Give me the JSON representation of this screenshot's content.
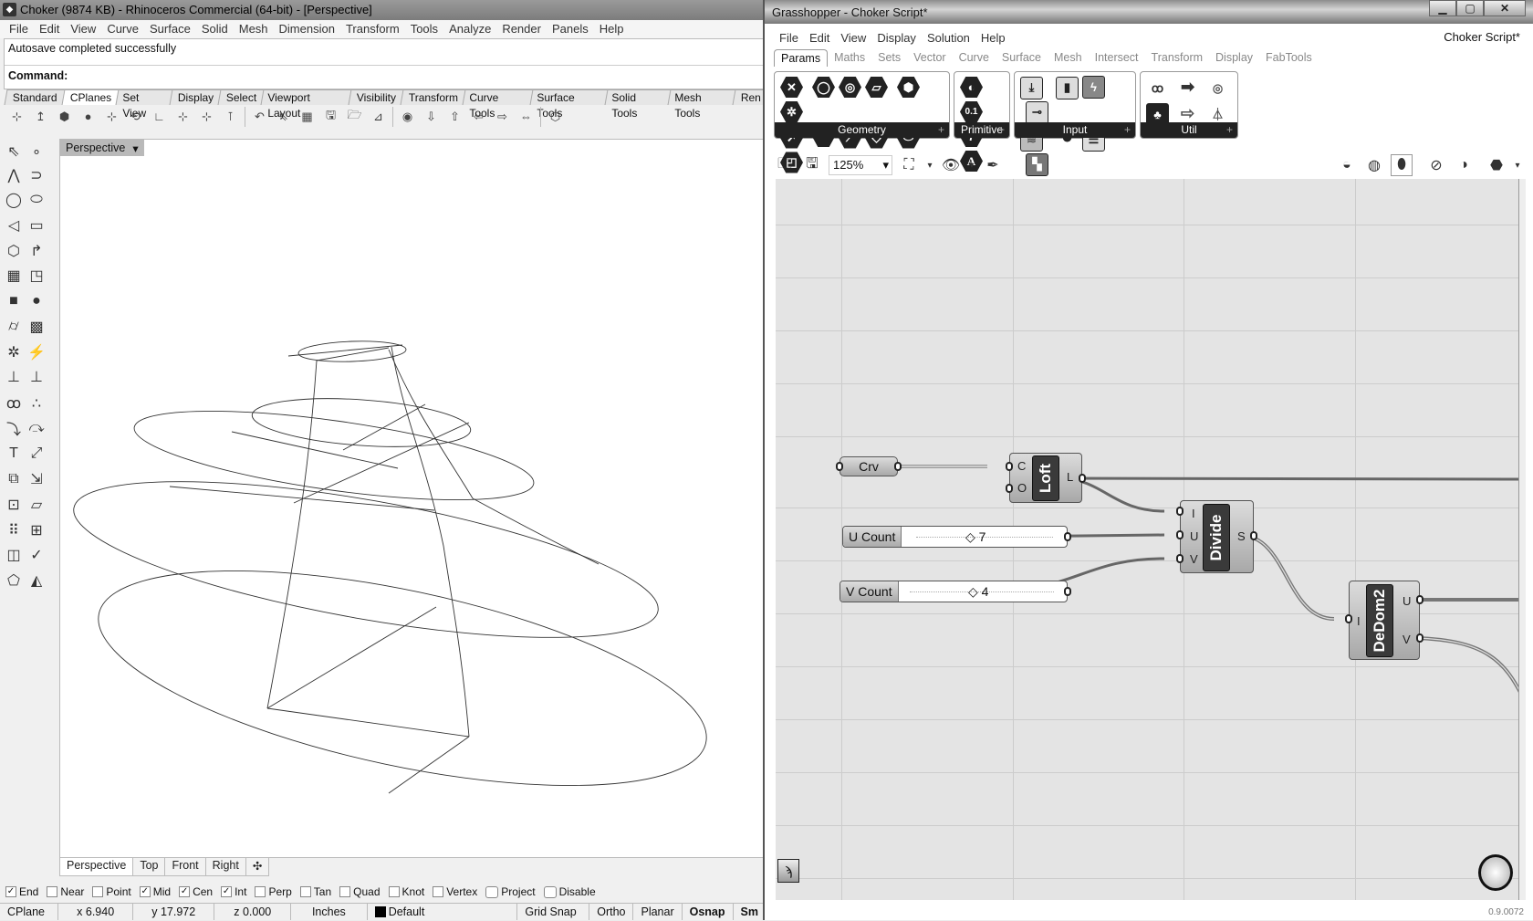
{
  "rhino": {
    "title": "Choker (9874 KB) - Rhinoceros Commercial (64-bit) - [Perspective]",
    "menu": [
      "File",
      "Edit",
      "View",
      "Curve",
      "Surface",
      "Solid",
      "Mesh",
      "Dimension",
      "Transform",
      "Tools",
      "Analyze",
      "Render",
      "Panels",
      "Help"
    ],
    "history": "Autosave completed successfully",
    "command_label": "Command:",
    "toolbar_tabs": [
      "Standard",
      "CPlanes",
      "Set View",
      "Display",
      "Select",
      "Viewport Layout",
      "Visibility",
      "Transform",
      "Curve Tools",
      "Surface Tools",
      "Solid Tools",
      "Mesh Tools",
      "Ren"
    ],
    "active_toolbar_tab": "CPlanes",
    "cplane_icons": [
      "cplane-world-top-icon",
      "cplane-elevation-icon",
      "cplane-to-object-icon",
      "cplane-to-surface-icon",
      "cplane-perpendicular-icon",
      "cplane-rotate-icon",
      "cplane-z-axis-icon",
      "cplane-3-point-icon",
      "cplane-x-axis-icon",
      "cplane-vertical-icon",
      "undo-cplane-icon",
      "set-cplane-by-object-icon",
      "grid-icon",
      "save-cplane-icon",
      "open-cplane-icon",
      "cplane-to-view-icon",
      "cplane-eye-icon",
      "cplane-down-icon",
      "cplane-up-icon",
      "cplane-left-icon",
      "cplane-front-icon",
      "cplane-arrows-icon",
      "cplane-named-icon"
    ],
    "viewport_label": "Perspective",
    "viewport_tabs": [
      "Perspective",
      "Top",
      "Front",
      "Right"
    ],
    "osnaps": [
      {
        "label": "End",
        "checked": true
      },
      {
        "label": "Near",
        "checked": false
      },
      {
        "label": "Point",
        "checked": false
      },
      {
        "label": "Mid",
        "checked": true
      },
      {
        "label": "Cen",
        "checked": true
      },
      {
        "label": "Int",
        "checked": true
      },
      {
        "label": "Perp",
        "checked": false
      },
      {
        "label": "Tan",
        "checked": false
      },
      {
        "label": "Quad",
        "checked": false
      },
      {
        "label": "Knot",
        "checked": false
      },
      {
        "label": "Vertex",
        "checked": false
      },
      {
        "label": "Project",
        "checked": false
      },
      {
        "label": "Disable",
        "checked": false
      }
    ],
    "status": {
      "cplane": "CPlane",
      "x": "x 6.940",
      "y": "y 17.972",
      "z": "z 0.000",
      "units": "Inches",
      "layer": "Default",
      "grid_snap": "Grid Snap",
      "ortho": "Ortho",
      "planar": "Planar",
      "osnap": "Osnap",
      "smarttrack": "Sm"
    }
  },
  "gh": {
    "title": "Grasshopper - Choker Script*",
    "menu": [
      "File",
      "Edit",
      "View",
      "Display",
      "Solution",
      "Help"
    ],
    "document": "Choker Script*",
    "tabs": [
      "Params",
      "Maths",
      "Sets",
      "Vector",
      "Curve",
      "Surface",
      "Mesh",
      "Intersect",
      "Transform",
      "Display",
      "FabTools"
    ],
    "active_tab": "Params",
    "groups": {
      "geometry": "Geometry",
      "primitive": "Primitive",
      "input": "Input",
      "util": "Util"
    },
    "zoom": "125%",
    "version": "0.9.0072",
    "nodes": {
      "crv": "Crv",
      "loft": {
        "name": "Loft",
        "inputs": [
          "C",
          "O"
        ],
        "outputs": [
          "L"
        ]
      },
      "u_slider": {
        "name": "U Count",
        "value": "7"
      },
      "v_slider": {
        "name": "V Count",
        "value": "4"
      },
      "divide": {
        "name": "Divide",
        "inputs": [
          "I",
          "U",
          "V"
        ],
        "outputs": [
          "S"
        ]
      },
      "dedom": {
        "name": "DeDom2",
        "inputs": [
          "I"
        ],
        "outputs": [
          "U",
          "V"
        ]
      }
    }
  }
}
